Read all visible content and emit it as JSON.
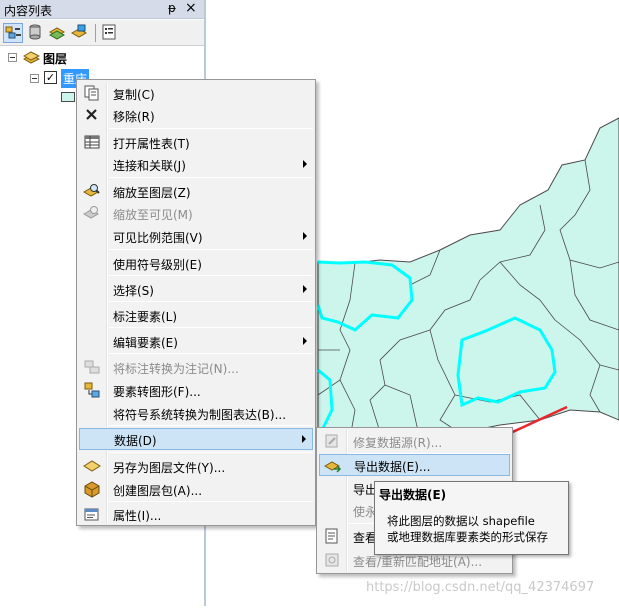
{
  "toc": {
    "title": "内容列表",
    "pin_glyph": "ᵽ",
    "close_glyph": "×",
    "toolbar_icons": [
      "list-by-drawing-order-icon",
      "list-by-source-icon",
      "list-by-visibility-icon",
      "list-by-selection-icon",
      "options-icon"
    ],
    "tree": {
      "root_label": "图层",
      "layer_label": "重庆",
      "layer_checked": true
    }
  },
  "context_menu": {
    "items": [
      {
        "label": "复制(C)",
        "icon": "copy-icon",
        "disabled": false,
        "submenu": false
      },
      {
        "label": "移除(R)",
        "icon": "remove-x-icon",
        "disabled": false,
        "submenu": false
      },
      {
        "label": "打开属性表(T)",
        "icon": "table-icon",
        "disabled": false,
        "submenu": false
      },
      {
        "label": "连接和关联(J)",
        "icon": "",
        "disabled": false,
        "submenu": true
      },
      {
        "label": "缩放至图层(Z)",
        "icon": "zoom-to-layer-icon",
        "disabled": false,
        "submenu": false
      },
      {
        "label": "缩放至可见(M)",
        "icon": "zoom-to-visible-icon",
        "disabled": true,
        "submenu": false
      },
      {
        "label": "可见比例范围(V)",
        "icon": "",
        "disabled": false,
        "submenu": true
      },
      {
        "label": "使用符号级别(E)",
        "icon": "",
        "disabled": false,
        "submenu": false
      },
      {
        "label": "选择(S)",
        "icon": "",
        "disabled": false,
        "submenu": true
      },
      {
        "label": "标注要素(L)",
        "icon": "",
        "disabled": false,
        "submenu": false
      },
      {
        "label": "编辑要素(E)",
        "icon": "",
        "disabled": false,
        "submenu": true
      },
      {
        "label": "将标注转换为注记(N)...",
        "icon": "convert-labels-icon",
        "disabled": true,
        "submenu": false
      },
      {
        "label": "要素转图形(F)...",
        "icon": "features-to-graphics-icon",
        "disabled": false,
        "submenu": false
      },
      {
        "label": "将符号系统转换为制图表达(B)...",
        "icon": "",
        "disabled": false,
        "submenu": false
      },
      {
        "label": "数据(D)",
        "icon": "",
        "disabled": false,
        "submenu": true,
        "highlighted": true
      },
      {
        "label": "另存为图层文件(Y)...",
        "icon": "save-layer-icon",
        "disabled": false,
        "submenu": false
      },
      {
        "label": "创建图层包(A)...",
        "icon": "layer-package-icon",
        "disabled": false,
        "submenu": false
      },
      {
        "label": "属性(I)...",
        "icon": "properties-icon",
        "disabled": false,
        "submenu": false
      }
    ]
  },
  "data_submenu": {
    "items": [
      {
        "label": "修复数据源(R)...",
        "icon": "repair-data-source-icon",
        "disabled": true
      },
      {
        "label": "导出数据(E)...",
        "icon": "export-data-icon",
        "disabled": false,
        "highlighted": true
      },
      {
        "label": "导出",
        "icon": "",
        "disabled": false
      },
      {
        "label": "使永",
        "icon": "",
        "disabled": true
      },
      {
        "label": "查看",
        "icon": "view-metadata-icon",
        "disabled": false
      },
      {
        "label": "查看/重新匹配地址(A)...",
        "icon": "rematch-addresses-icon",
        "disabled": true
      }
    ]
  },
  "tooltip": {
    "title": "导出数据(E)",
    "line1": "将此图层的数据以 shapefile",
    "line2": "或地理数据库要素类的形式保存"
  },
  "watermark": "https://blog.csdn.net/qq_42374697",
  "colors": {
    "map_fill": "#ccf5ec",
    "map_border": "#4a4a4a",
    "selected_boundary": "#00ffff",
    "annotation_arrow": "#e8262b",
    "menu_highlight": "#cde4f7"
  }
}
